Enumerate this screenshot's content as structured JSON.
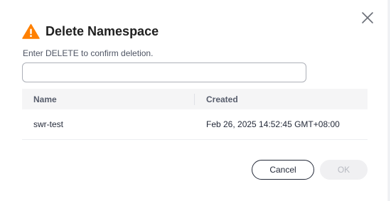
{
  "dialog": {
    "title": "Delete Namespace",
    "hint": "Enter DELETE to confirm deletion.",
    "input": {
      "value": "",
      "placeholder": ""
    },
    "icons": {
      "close": "close-icon",
      "warning": "warning-icon"
    },
    "colors": {
      "warning": "#ff8000",
      "cancel_border": "#252b3a",
      "ok_disabled_bg": "#f0f0f2"
    }
  },
  "table": {
    "columns": [
      "Name",
      "Created"
    ],
    "rows": [
      {
        "name": "swr-test",
        "created": "Feb 26, 2025 14:52:45 GMT+08:00"
      }
    ]
  },
  "buttons": {
    "cancel": "Cancel",
    "ok": "OK"
  }
}
